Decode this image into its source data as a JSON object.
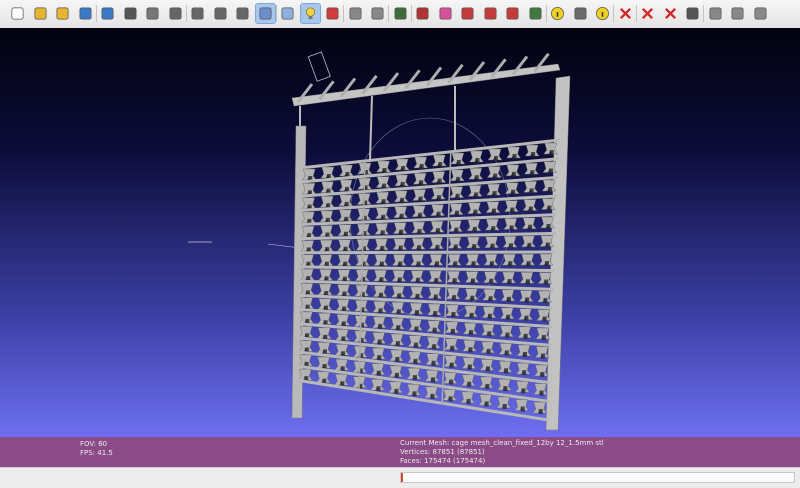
{
  "toolbar": {
    "buttons": [
      {
        "name": "new-project-icon",
        "color": "#ffffff"
      },
      {
        "name": "open-project-icon",
        "color": "#e8b530"
      },
      {
        "name": "import-mesh-icon",
        "color": "#e8b530"
      },
      {
        "name": "reload-icon",
        "color": "#3a78c8"
      },
      {
        "name": "export-mesh-icon",
        "color": "#3a78c8"
      },
      {
        "name": "snapshot-icon",
        "color": "#555555"
      },
      {
        "name": "layers-icon",
        "color": "#777777"
      },
      {
        "name": "bbox-view-icon",
        "color": "#666666"
      },
      {
        "name": "points-view-icon",
        "color": "#666666"
      },
      {
        "name": "wireframe-view-icon",
        "color": "#666666"
      },
      {
        "name": "hidden-lines-icon",
        "color": "#666666"
      },
      {
        "name": "flat-shading-icon",
        "color": "#6a8fcf",
        "active": true
      },
      {
        "name": "smooth-shading-icon",
        "color": "#8fb0df"
      },
      {
        "name": "light-icon",
        "color": "#f2d24a",
        "active": true
      },
      {
        "name": "backface-icon",
        "color": "#d23b3b"
      },
      {
        "name": "texture-icon",
        "color": "#888888"
      },
      {
        "name": "select-tool-icon",
        "color": "#888888"
      },
      {
        "name": "measure-tool-icon",
        "color": "#3b6d3b"
      },
      {
        "name": "align-tool-icon",
        "color": "#b23333"
      },
      {
        "name": "paint-tool-icon",
        "color": "#d84f9c"
      },
      {
        "name": "select-vertices-icon",
        "color": "#c63a3a"
      },
      {
        "name": "select-faces-icon",
        "color": "#c63a3a"
      },
      {
        "name": "pick-points-icon",
        "color": "#c63a3a"
      },
      {
        "name": "raster-icon",
        "color": "#3e7a3e"
      },
      {
        "name": "annotation-icon",
        "color": "#f0d020"
      },
      {
        "name": "brush-icon",
        "color": "#6a6a6a"
      },
      {
        "name": "info-icon",
        "color": "#f0d020"
      },
      {
        "name": "delete-vertices-icon",
        "color": "#d22b2b"
      },
      {
        "name": "delete-faces-icon",
        "color": "#d22b2b"
      },
      {
        "name": "delete-selection-icon",
        "color": "#d22b2b"
      },
      {
        "name": "camera-icon",
        "color": "#555555"
      },
      {
        "name": "window-tile-icon",
        "color": "#888888"
      },
      {
        "name": "window-cascade-icon",
        "color": "#888888"
      },
      {
        "name": "window-close-icon",
        "color": "#888888"
      }
    ]
  },
  "info": {
    "fov": "FOV: 60",
    "fps": "FPS:   41.5",
    "mesh": "Current Mesh: cage mesh_clean_fixed_12by 12_1.5mm stl",
    "vertices": "Vertices: 87851 (87851)",
    "faces": "Faces: 175474 (175474)"
  },
  "status": {
    "progress_fraction": 0.005,
    "progress_color": "#d24a2e"
  },
  "colors": {
    "viewport_top": "#02020f",
    "viewport_bottom": "#6e6ff0",
    "info_band": "#8a4b86",
    "mesh": "#b8b8b8"
  }
}
